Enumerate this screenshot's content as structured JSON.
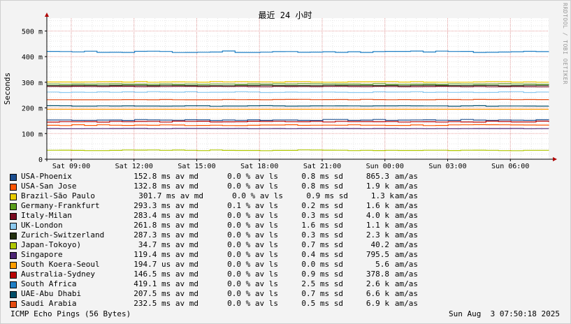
{
  "chart_data": {
    "type": "line",
    "title": "最近 24 小时",
    "ylabel": "Seconds",
    "watermark": "RRDTOOL / TOBI OETIKER",
    "ylim": [
      0,
      0.55
    ],
    "xlim": [
      "Sat 07:50",
      "Sun 07:50"
    ],
    "y_ticks": [
      {
        "value": 0,
        "label": "0"
      },
      {
        "value": 0.1,
        "label": "100 m"
      },
      {
        "value": 0.2,
        "label": "200 m"
      },
      {
        "value": 0.3,
        "label": "300 m"
      },
      {
        "value": 0.4,
        "label": "400 m"
      },
      {
        "value": 0.5,
        "label": "500 m"
      }
    ],
    "x_ticks": [
      {
        "hours": 1.17,
        "label": "Sat 09:00"
      },
      {
        "hours": 4.17,
        "label": "Sat 12:00"
      },
      {
        "hours": 7.17,
        "label": "Sat 15:00"
      },
      {
        "hours": 10.17,
        "label": "Sat 18:00"
      },
      {
        "hours": 13.17,
        "label": "Sat 21:00"
      },
      {
        "hours": 16.17,
        "label": "Sun 00:00"
      },
      {
        "hours": 19.17,
        "label": "Sun 03:00"
      },
      {
        "hours": 22.17,
        "label": "Sun 06:00"
      }
    ],
    "grid": true,
    "series": [
      {
        "name": "USA-Phoenix",
        "color": "#1a4d8f",
        "avg": 0.1528,
        "jitter": 0.002
      },
      {
        "name": "USA-San Jose",
        "color": "#ff5500",
        "avg": 0.1328,
        "jitter": 0.002
      },
      {
        "name": "Brazil-São Paulo",
        "color": "#e8cc00",
        "avg": 0.3017,
        "jitter": 0.0015
      },
      {
        "name": "Germany-Frankfurt",
        "color": "#5a9e1c",
        "avg": 0.2933,
        "jitter": 0.001
      },
      {
        "name": "Italy-Milan",
        "color": "#7a0b20",
        "avg": 0.2834,
        "jitter": 0.001
      },
      {
        "name": "UK-London",
        "color": "#8ccaf0",
        "avg": 0.2618,
        "jitter": 0.002
      },
      {
        "name": "Zurich-Switzerland",
        "color": "#222f0e",
        "avg": 0.2873,
        "jitter": 0.001
      },
      {
        "name": "Japan-Tokoyo)",
        "color": "#b0c800",
        "avg": 0.0347,
        "jitter": 0.0015
      },
      {
        "name": "Singapore",
        "color": "#4c2473",
        "avg": 0.1194,
        "jitter": 0.0005
      },
      {
        "name": "South Koera-Seoul",
        "color": "#ff9d00",
        "avg": 0.1947,
        "jitter": 0.0
      },
      {
        "name": "Australia-Sydney",
        "color": "#b80000",
        "avg": 0.1465,
        "jitter": 0.002
      },
      {
        "name": "South Africa",
        "color": "#1f7ec4",
        "avg": 0.4191,
        "jitter": 0.003
      },
      {
        "name": "UAE-Abu Dhabi",
        "color": "#004d68",
        "avg": 0.2075,
        "jitter": 0.001
      },
      {
        "name": "Saudi Arabia",
        "color": "#e54c10",
        "avg": 0.2325,
        "jitter": 0.001
      }
    ]
  },
  "legend": [
    {
      "name": "USA-Phoenix",
      "color": "#1a4d8f",
      "avg": "152.8 ms av md",
      "loss": "0.0 % av ls",
      "sd": "0.8 ms sd",
      "ratio": "865.3",
      "unit": "am/as"
    },
    {
      "name": "USA-San Jose",
      "color": "#ff5500",
      "avg": "132.8 ms av md",
      "loss": "0.0 % av ls",
      "sd": "0.8 ms sd",
      "ratio": "1.9 k",
      "unit": "am/as"
    },
    {
      "name": "Brazil-São Paulo",
      "color": "#e8cc00",
      "avg": "301.7 ms av md",
      "loss": "0.0 % av ls",
      "sd": "0.9 ms sd",
      "ratio": "1.3 k",
      "unit": "am/as",
      "shift": true
    },
    {
      "name": "Germany-Frankfurt",
      "color": "#5a9e1c",
      "avg": "293.3 ms av md",
      "loss": "0.1 % av ls",
      "sd": "0.2 ms sd",
      "ratio": "1.6 k",
      "unit": "am/as"
    },
    {
      "name": "Italy-Milan",
      "color": "#7a0b20",
      "avg": "283.4 ms av md",
      "loss": "0.0 % av ls",
      "sd": "0.3 ms sd",
      "ratio": "4.0 k",
      "unit": "am/as"
    },
    {
      "name": "UK-London",
      "color": "#8ccaf0",
      "avg": "261.8 ms av md",
      "loss": "0.0 % av ls",
      "sd": "1.6 ms sd",
      "ratio": "1.1 k",
      "unit": "am/as"
    },
    {
      "name": "Zurich-Switzerland",
      "color": "#222f0e",
      "avg": "287.3 ms av md",
      "loss": "0.0 % av ls",
      "sd": "0.3 ms sd",
      "ratio": "2.3 k",
      "unit": "am/as"
    },
    {
      "name": "Japan-Tokoyo)",
      "color": "#b0c800",
      "avg": "34.7 ms av md",
      "loss": "0.0 % av ls",
      "sd": "0.7 ms sd",
      "ratio": "40.2",
      "unit": "am/as"
    },
    {
      "name": "Singapore",
      "color": "#4c2473",
      "avg": "119.4 ms av md",
      "loss": "0.0 % av ls",
      "sd": "0.4 ms sd",
      "ratio": "795.5",
      "unit": "am/as"
    },
    {
      "name": "South Koera-Seoul",
      "color": "#ff9d00",
      "avg": "194.7 us av md",
      "loss": "0.0 % av ls",
      "sd": "0.0 ms sd",
      "ratio": "5.6",
      "unit": "am/as"
    },
    {
      "name": "Australia-Sydney",
      "color": "#b80000",
      "avg": "146.5 ms av md",
      "loss": "0.0 % av ls",
      "sd": "0.9 ms sd",
      "ratio": "378.8",
      "unit": "am/as"
    },
    {
      "name": "South Africa",
      "color": "#1f7ec4",
      "avg": "419.1 ms av md",
      "loss": "0.0 % av ls",
      "sd": "2.5 ms sd",
      "ratio": "2.6 k",
      "unit": "am/as"
    },
    {
      "name": "UAE-Abu Dhabi",
      "color": "#004d68",
      "avg": "207.5 ms av md",
      "loss": "0.0 % av ls",
      "sd": "0.7 ms sd",
      "ratio": "6.6 k",
      "unit": "am/as"
    },
    {
      "name": "Saudi Arabia",
      "color": "#e54c10",
      "avg": "232.5 ms av md",
      "loss": "0.0 % av ls",
      "sd": "0.5 ms sd",
      "ratio": "6.9 k",
      "unit": "am/as"
    }
  ],
  "footer": {
    "probe": "ICMP Echo Pings (56 Bytes)",
    "timestamp": "Sun Aug  3 07:50:18 2025"
  }
}
